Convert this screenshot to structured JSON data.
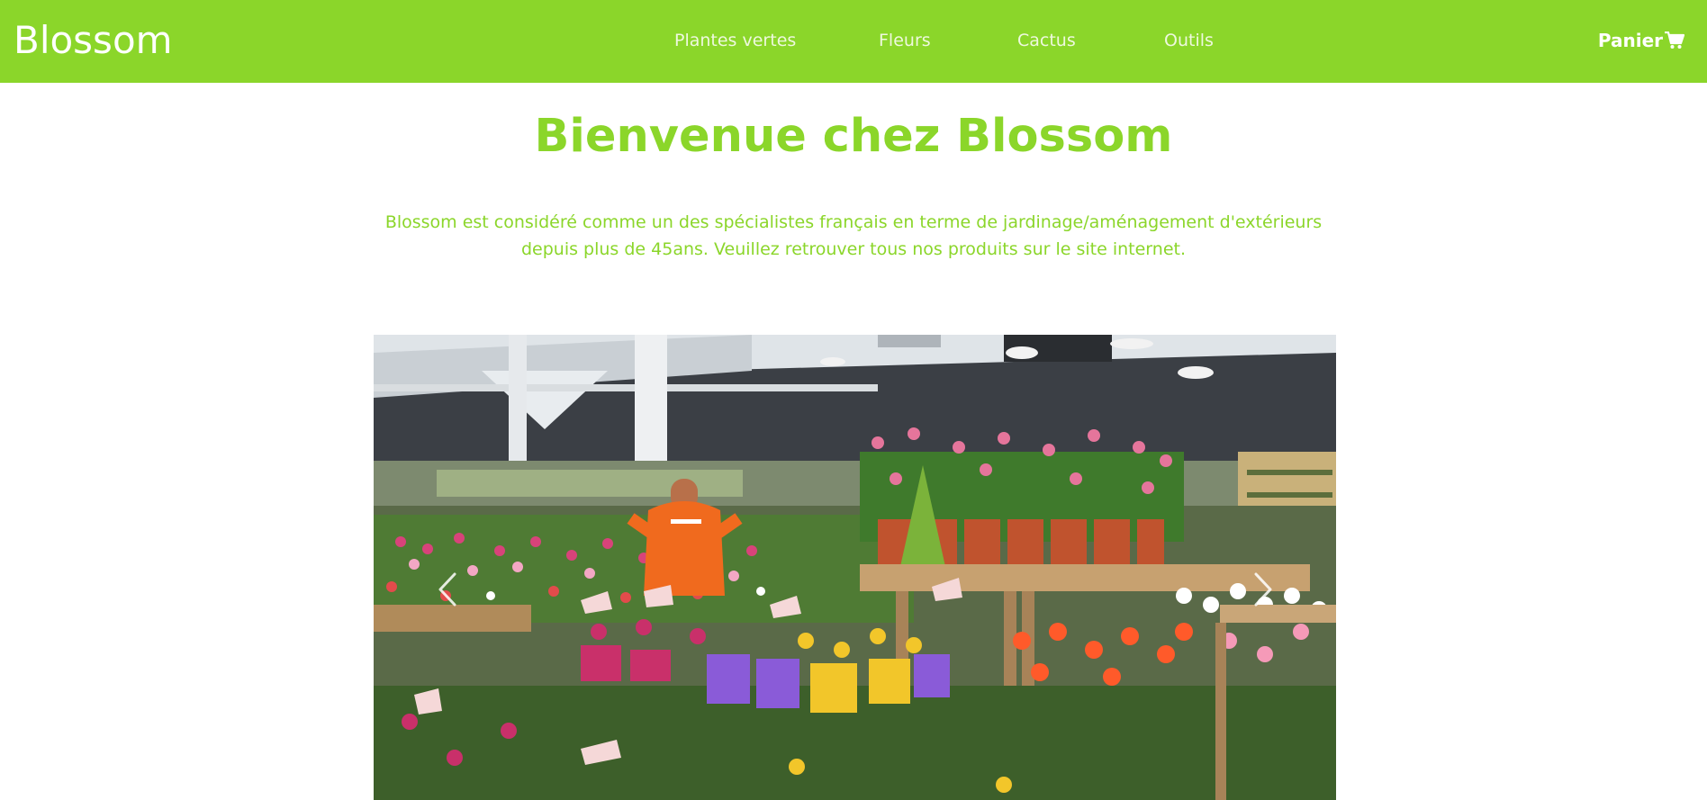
{
  "brand": {
    "name": "Blossom"
  },
  "nav": {
    "items": [
      {
        "label": "Plantes vertes"
      },
      {
        "label": "Fleurs"
      },
      {
        "label": "Cactus"
      },
      {
        "label": "Outils"
      }
    ],
    "cart_label": "Panier"
  },
  "hero": {
    "title": "Bienvenue chez Blossom",
    "text": "Blossom est considéré comme un des spécialistes français en terme de jardinage/aménagement d'extérieurs depuis plus de 45ans. Veuillez retrouver tous nos produits sur le site internet."
  },
  "carousel": {
    "image_subject": "garden-center-flower-display",
    "prev_icon": "chevron-left-icon",
    "next_icon": "chevron-right-icon"
  },
  "colors": {
    "accent": "#8bd62a",
    "nav_text": "#eef8de",
    "white": "#ffffff"
  }
}
